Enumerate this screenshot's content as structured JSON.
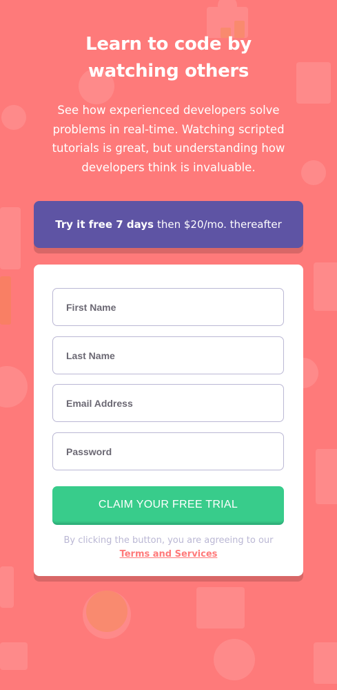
{
  "hero": {
    "title_line1": "Learn to code by",
    "title_line2": "watching others",
    "copy_line1": "See how experienced developers solve",
    "copy_line2": "problems in real-time. Watching scripted",
    "copy_line3": "tutorials is great, but understanding how",
    "copy_line4": "developers think is invaluable."
  },
  "promo": {
    "strong_text": "Try it free 7 days",
    "rest_text": "then $20/mo. thereafter"
  },
  "form": {
    "first_name_placeholder": "First Name",
    "last_name_placeholder": "Last Name",
    "email_placeholder": "Email Address",
    "password_placeholder": "Password",
    "submit_label": "CLAIM YOUR FREE TRIAL",
    "terms_prefix": "By clicking the button, you are agreeing to our",
    "terms_link": "Terms and Services"
  },
  "colors": {
    "background": "#fe7a7a",
    "banner": "#5e54a4",
    "button": "#38cc8b",
    "field_border": "#bab7d4",
    "link": "#ff7a7a"
  }
}
